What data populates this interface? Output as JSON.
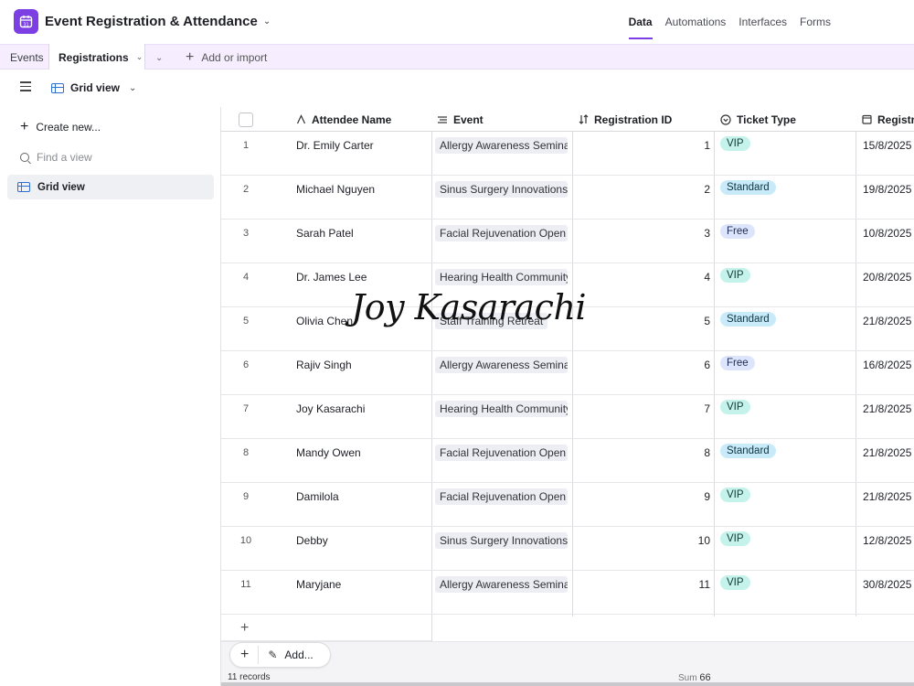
{
  "header": {
    "base_title": "Event Registration & Attendance",
    "nav": [
      {
        "label": "Data",
        "active": true
      },
      {
        "label": "Automations",
        "active": false
      },
      {
        "label": "Interfaces",
        "active": false
      },
      {
        "label": "Forms",
        "active": false
      }
    ]
  },
  "tabs": {
    "events": "Events",
    "registrations": "Registrations",
    "add_import": "Add or import"
  },
  "viewbar": {
    "view_name": "Grid view"
  },
  "sidebar": {
    "create_new": "Create new...",
    "find_placeholder": "Find a view",
    "views": [
      "Grid view"
    ]
  },
  "grid": {
    "columns": {
      "name": "Attendee Name",
      "event": "Event",
      "regid": "Registration ID",
      "ticket": "Ticket Type",
      "date": "Registra"
    },
    "rows": [
      {
        "num": "1",
        "name": "Dr. Emily Carter",
        "event": "Allergy Awareness Seminar",
        "regid": "1",
        "ticket": "VIP",
        "date": "15/8/2025"
      },
      {
        "num": "2",
        "name": "Michael Nguyen",
        "event": "Sinus Surgery Innovations Wo",
        "regid": "2",
        "ticket": "Standard",
        "date": "19/8/2025"
      },
      {
        "num": "3",
        "name": "Sarah Patel",
        "event": "Facial Rejuvenation Open Ho",
        "regid": "3",
        "ticket": "Free",
        "date": "10/8/2025"
      },
      {
        "num": "4",
        "name": "Dr. James Lee",
        "event": "Hearing Health Community D",
        "regid": "4",
        "ticket": "VIP",
        "date": "20/8/2025"
      },
      {
        "num": "5",
        "name": "Olivia Chen",
        "event": "Staff Training Retreat",
        "regid": "5",
        "ticket": "Standard",
        "date": "21/8/2025"
      },
      {
        "num": "6",
        "name": "Rajiv Singh",
        "event": "Allergy Awareness Seminar",
        "regid": "6",
        "ticket": "Free",
        "date": "16/8/2025"
      },
      {
        "num": "7",
        "name": "Joy Kasarachi",
        "event": "Hearing Health Community D",
        "regid": "7",
        "ticket": "VIP",
        "date": "21/8/2025"
      },
      {
        "num": "8",
        "name": "Mandy Owen",
        "event": "Facial Rejuvenation Open Ho",
        "regid": "8",
        "ticket": "Standard",
        "date": "21/8/2025"
      },
      {
        "num": "9",
        "name": "Damilola",
        "event": "Facial Rejuvenation Open Ho",
        "regid": "9",
        "ticket": "VIP",
        "date": "21/8/2025"
      },
      {
        "num": "10",
        "name": "Debby",
        "event": "Sinus Surgery Innovations Wo",
        "regid": "10",
        "ticket": "VIP",
        "date": "12/8/2025"
      },
      {
        "num": "11",
        "name": "Maryjane",
        "event": "Allergy Awareness Seminar",
        "regid": "11",
        "ticket": "VIP",
        "date": "30/8/2025"
      }
    ]
  },
  "footer": {
    "add_label": "Add...",
    "records": "11 records",
    "sum_label": "Sum",
    "sum_value": "66"
  },
  "overlay": {
    "signature": "Joy Kasarachi"
  },
  "colors": {
    "accent": "#7b3fe4",
    "vip": "#c6f2ec",
    "standard": "#c9ebf9",
    "free": "#dce5fb"
  }
}
